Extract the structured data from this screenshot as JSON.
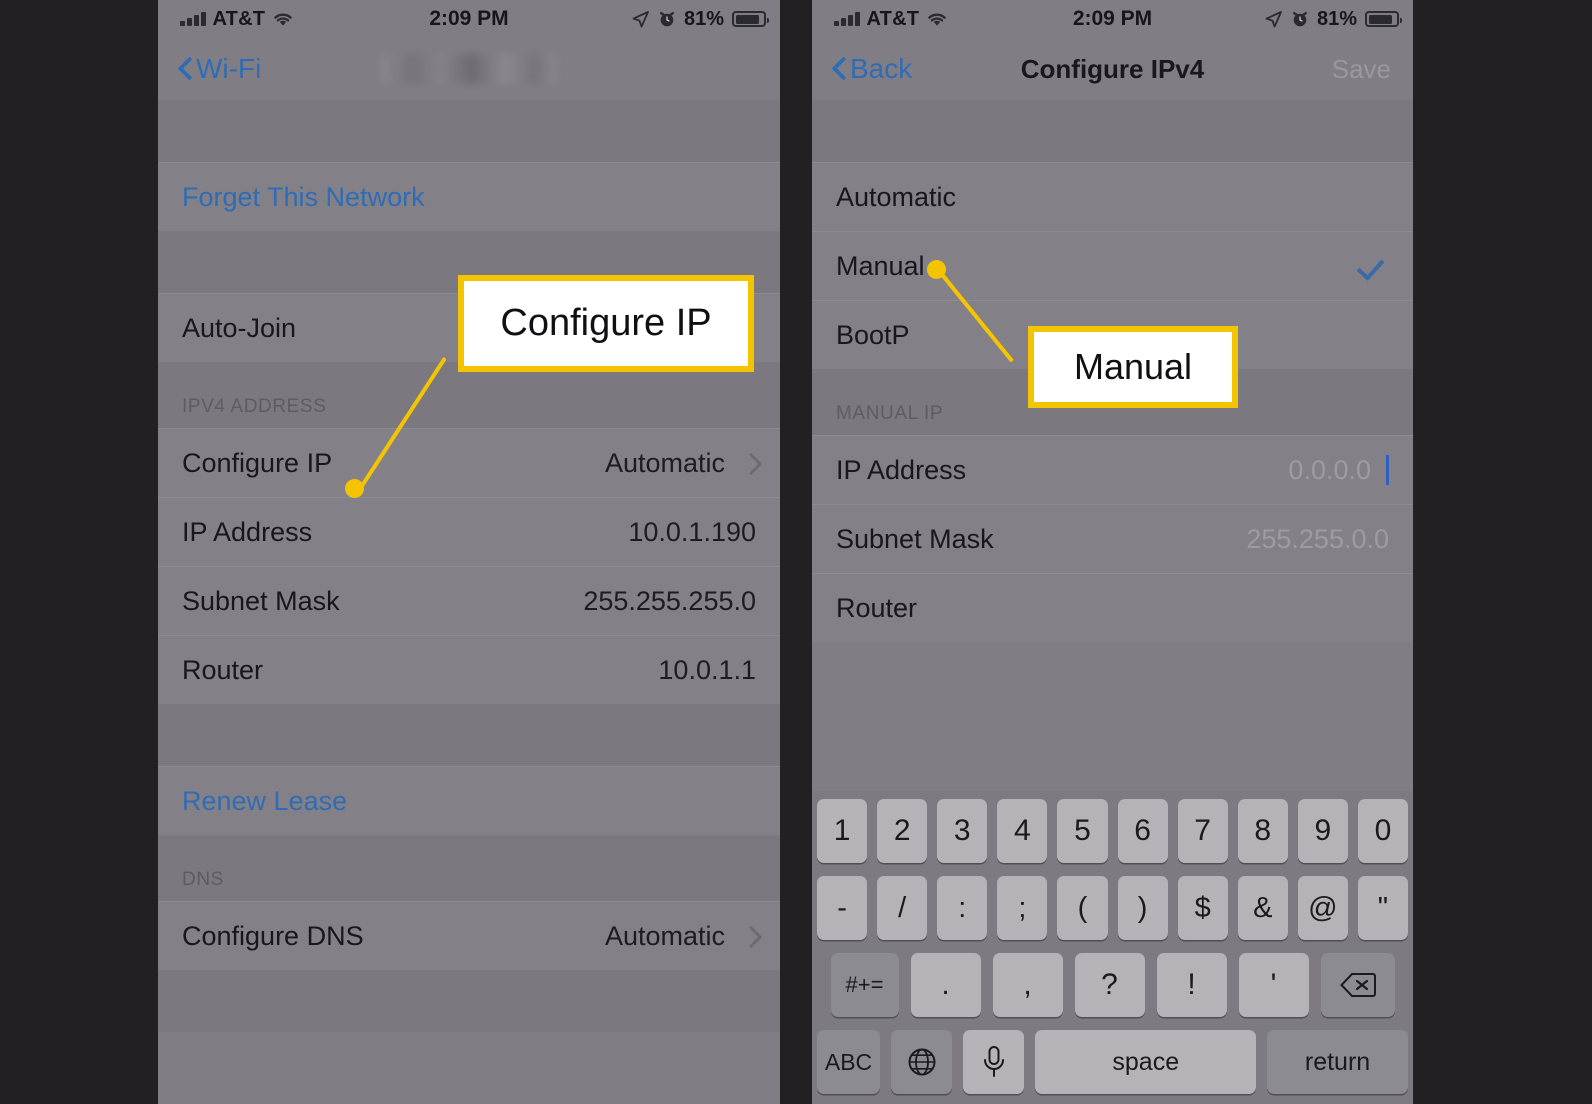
{
  "left_phone": {
    "status_bar": {
      "carrier": "AT&T",
      "time": "2:09 PM",
      "battery_percent": "81%",
      "signal_icon": "cellular-bars-icon",
      "wifi_icon": "wifi-icon",
      "location_icon": "location-arrow-icon",
      "alarm_icon": "alarm-clock-icon",
      "battery_icon": "battery-icon"
    },
    "nav": {
      "back_label": "Wi-Fi",
      "title_redacted": "",
      "back_icon": "chevron-left-icon"
    },
    "rows": {
      "forget_network": "Forget This Network",
      "auto_join": "Auto-Join",
      "section_ipv4": "IPV4 ADDRESS",
      "configure_ip_label": "Configure IP",
      "configure_ip_value": "Automatic",
      "ip_address_label": "IP Address",
      "ip_address_value": "10.0.1.190",
      "subnet_label": "Subnet Mask",
      "subnet_value": "255.255.255.0",
      "router_label": "Router",
      "router_value": "10.0.1.1",
      "renew_lease": "Renew Lease",
      "section_dns": "DNS",
      "configure_dns_label": "Configure DNS",
      "configure_dns_value": "Automatic"
    }
  },
  "right_phone": {
    "status_bar": {
      "carrier": "AT&T",
      "time": "2:09 PM",
      "battery_percent": "81%",
      "signal_icon": "cellular-bars-icon",
      "wifi_icon": "wifi-icon",
      "location_icon": "location-arrow-icon",
      "alarm_icon": "alarm-clock-icon",
      "battery_icon": "battery-icon"
    },
    "nav": {
      "back_label": "Back",
      "title": "Configure IPv4",
      "save_label": "Save",
      "back_icon": "chevron-left-icon"
    },
    "options": [
      {
        "label": "Automatic",
        "selected": false
      },
      {
        "label": "Manual",
        "selected": true
      },
      {
        "label": "BootP",
        "selected": false
      }
    ],
    "manual_section": {
      "header": "MANUAL IP",
      "ip_address_label": "IP Address",
      "ip_address_placeholder": "0.0.0.0",
      "subnet_label": "Subnet Mask",
      "subnet_placeholder": "255.255.0.0",
      "router_label": "Router",
      "router_placeholder": ""
    },
    "keyboard": {
      "row1": [
        "1",
        "2",
        "3",
        "4",
        "5",
        "6",
        "7",
        "8",
        "9",
        "0"
      ],
      "row2": [
        "-",
        "/",
        ":",
        ";",
        "(",
        ")",
        "$",
        "&",
        "@",
        "\""
      ],
      "row3_symbols_key": "#+=",
      "row3": [
        ".",
        ",",
        "?",
        "!",
        "'"
      ],
      "row3_delete_icon": "delete-left-icon",
      "row4_abc": "ABC",
      "row4_globe_icon": "globe-icon",
      "row4_mic_icon": "microphone-icon",
      "row4_space": "space",
      "row4_return": "return"
    }
  },
  "callouts": {
    "configure_ip": "Configure IP",
    "manual": "Manual"
  },
  "colors": {
    "accent_yellow": "#F2C500",
    "ios_blue": "#2F6CB5",
    "panel_bg": "#807E84",
    "backdrop": "#232024"
  }
}
